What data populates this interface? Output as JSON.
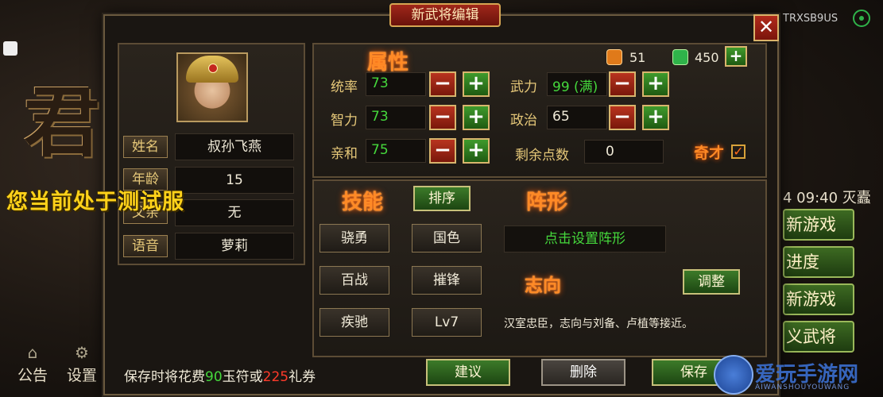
{
  "dialog": {
    "title": "新武将编辑",
    "close_label": "✕"
  },
  "background": {
    "calligraphy": "君",
    "test_banner": "您当前处于测试服",
    "user_code": "TRXSB9US",
    "time_text": "4 09:40 灭蠹",
    "menu_buttons": [
      "新游戏",
      "进度",
      "新游戏",
      "义武将"
    ],
    "bottom_icons": [
      {
        "label": "公告",
        "icon": "bulletin-icon"
      },
      {
        "label": "设置",
        "icon": "gear-icon"
      }
    ]
  },
  "profile": {
    "portrait_icon": "general-portrait",
    "fields": [
      {
        "label": "姓名",
        "value": "叔孙飞燕"
      },
      {
        "label": "年龄",
        "value": "15"
      },
      {
        "label": "父亲",
        "value": "无"
      },
      {
        "label": "语音",
        "value": "萝莉"
      }
    ]
  },
  "attributes": {
    "title": "属性",
    "currency": [
      {
        "icon": "token-icon",
        "value": "51",
        "color": "#e07a1a"
      },
      {
        "icon": "jade-icon",
        "value": "450",
        "color": "#2fb34a"
      }
    ],
    "add_currency_label": "+",
    "stats": [
      {
        "label": "统率",
        "value": "73",
        "color": "green"
      },
      {
        "label": "武力",
        "value": "99 (满)",
        "color": "green"
      },
      {
        "label": "智力",
        "value": "73",
        "color": "green"
      },
      {
        "label": "政治",
        "value": "65",
        "color": "white"
      },
      {
        "label": "亲和",
        "value": "75",
        "color": "green"
      }
    ],
    "remaining_label": "剩余点数",
    "remaining_value": "0",
    "genius_label": "奇才",
    "genius_checked": "✓",
    "minus_label": "−",
    "plus_label": "+"
  },
  "skills": {
    "title": "技能",
    "sort_label": "排序",
    "items": [
      "骁勇",
      "国色",
      "百战",
      "摧锋",
      "疾驰",
      "Lv7"
    ]
  },
  "formation": {
    "title": "阵形",
    "set_label": "点击设置阵形"
  },
  "ambition": {
    "title": "志向",
    "adjust_label": "调整",
    "description": "汉室忠臣，志向与刘备、卢植等接近。"
  },
  "footer": {
    "cost_prefix": "保存时将花费",
    "jade_cost": "90",
    "mid_text": "玉符或",
    "coupon_cost": "225",
    "suffix": "礼券",
    "suggest_label": "建议",
    "delete_label": "删除",
    "save_label": "保存"
  },
  "watermark": {
    "text": "爱玩手游网",
    "sub": "AIWANSHOUYOUWANG"
  }
}
